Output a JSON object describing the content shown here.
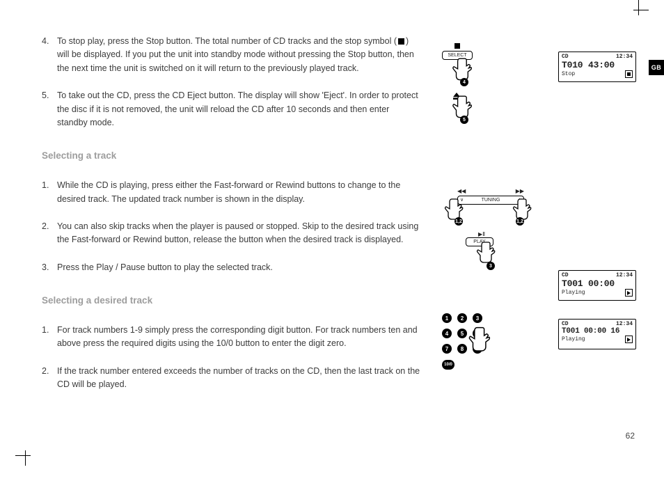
{
  "lang_badge": "GB",
  "page_number": "62",
  "intro_steps": [
    {
      "n": "4.",
      "text_before": "To stop play, press the Stop button. The total number of CD tracks and the stop symbol (",
      "text_after": ") will be displayed. If you put the unit into standby mode without pressing the Stop button, then the next time the unit is switched on it will return to the previously played track."
    },
    {
      "n": "5.",
      "text": "To take out the CD, press the CD Eject button. The display will show 'Eject'. In order to protect the disc if it is not removed, the unit will reload the CD after 10 seconds and then enter standby mode."
    }
  ],
  "sections": [
    {
      "title": "Selecting a track",
      "steps": [
        {
          "n": "1.",
          "text": "While the CD is playing, press either the Fast-forward or Rewind buttons to change to the desired track. The updated track number is shown in the display."
        },
        {
          "n": "2.",
          "text": "You can also skip tracks when the player is paused or stopped. Skip to the desired track using the Fast-forward or Rewind button, release the button when the desired track is displayed."
        },
        {
          "n": "3.",
          "text": "Press the Play / Pause button to play the selected track."
        }
      ]
    },
    {
      "title": "Selecting a desired track",
      "steps": [
        {
          "n": "1.",
          "text": "For track numbers 1-9 simply press the corresponding digit button. For track numbers ten and above press the required digits using the 10/0 button to enter the digit zero."
        },
        {
          "n": "2.",
          "text": "If the track number entered exceeds the number of tracks on the CD, then the last track on the CD will be played."
        }
      ]
    }
  ],
  "lcd": [
    {
      "mode": "CD",
      "clock": "12:34",
      "track": "T010 43:00",
      "status": "Stop",
      "icon": "stop"
    },
    {
      "mode": "CD",
      "clock": "12:34",
      "track": "T001 00:00",
      "status": "Playing",
      "icon": "play"
    },
    {
      "mode": "CD",
      "clock": "12:34",
      "track": "T001 00:00  16",
      "status": "Playing",
      "icon": "play"
    }
  ],
  "illus": {
    "select_label": "SELECT",
    "select_step": "4",
    "eject_step": "5",
    "tuning_label": "TUNING",
    "tuning_step": "1,2",
    "play_label": "PLAY",
    "play_step": "3",
    "keypad": [
      "1",
      "2",
      "3",
      "4",
      "5",
      "6",
      "7",
      "8",
      "9"
    ],
    "keypad_ten": "10/0"
  }
}
